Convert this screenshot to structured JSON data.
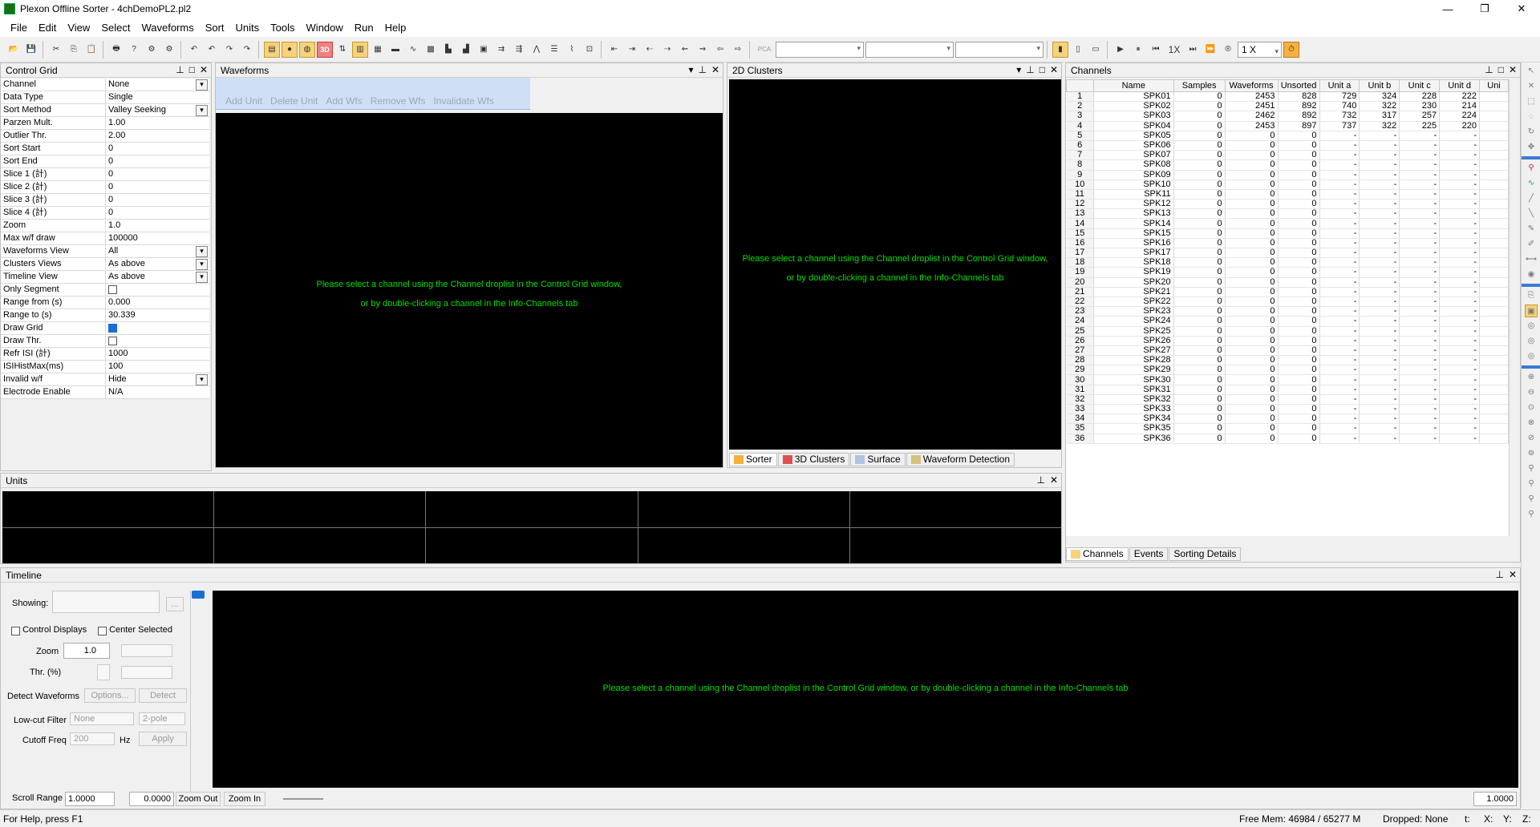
{
  "window": {
    "title": "Plexon Offline Sorter - 4chDemoPL2.pl2",
    "minimize": "—",
    "maximize": "❐",
    "close": "✕"
  },
  "menu": [
    "File",
    "Edit",
    "View",
    "Select",
    "Waveforms",
    "Sort",
    "Units",
    "Tools",
    "Window",
    "Run",
    "Help"
  ],
  "toolbar": {
    "pca_label": "PCA",
    "speed_label": "1X",
    "speed_value": "1 X"
  },
  "control_grid": {
    "title": "Control Grid",
    "rows": [
      {
        "k": "Channel",
        "v": "None",
        "type": "dd"
      },
      {
        "k": "Data Type",
        "v": "Single",
        "type": "text"
      },
      {
        "k": "Sort Method",
        "v": "Valley Seeking",
        "type": "dd"
      },
      {
        "k": "Parzen Mult.",
        "v": "1.00",
        "type": "text"
      },
      {
        "k": "Outlier Thr.",
        "v": "2.00",
        "type": "text"
      },
      {
        "k": "Sort Start",
        "v": "0",
        "type": "text"
      },
      {
        "k": "Sort End",
        "v": "0",
        "type": "text"
      },
      {
        "k": "Slice 1 (計)",
        "v": "0",
        "type": "text"
      },
      {
        "k": "Slice 2 (計)",
        "v": "0",
        "type": "text"
      },
      {
        "k": "Slice 3 (計)",
        "v": "0",
        "type": "text"
      },
      {
        "k": "Slice 4 (計)",
        "v": "0",
        "type": "text"
      },
      {
        "k": "Zoom",
        "v": "1.0",
        "type": "text"
      },
      {
        "k": "Max w/f draw",
        "v": "100000",
        "type": "text"
      },
      {
        "k": "Waveforms View",
        "v": "All",
        "type": "dd"
      },
      {
        "k": "Clusters Views",
        "v": "As above",
        "type": "dd"
      },
      {
        "k": "Timeline View",
        "v": "As above",
        "type": "dd"
      },
      {
        "k": "Only Segment",
        "v": "",
        "type": "chk"
      },
      {
        "k": "  Range from (s)",
        "v": "0.000",
        "type": "text"
      },
      {
        "k": "  Range to (s)",
        "v": "30.339",
        "type": "text"
      },
      {
        "k": "Draw Grid",
        "v": "",
        "type": "chkon"
      },
      {
        "k": "Draw Thr.",
        "v": "",
        "type": "chk"
      },
      {
        "k": "Refr ISI (計)",
        "v": "1000",
        "type": "text"
      },
      {
        "k": "ISIHistMax(ms)",
        "v": "100",
        "type": "text"
      },
      {
        "k": "Invalid w/f",
        "v": "Hide",
        "type": "dd"
      },
      {
        "k": "Electrode Enable",
        "v": "N/A",
        "type": "text"
      }
    ]
  },
  "waveforms": {
    "title": "Waveforms",
    "buttons": [
      "Add Unit",
      "Delete Unit",
      "Add Wfs",
      "Remove Wfs",
      "Invalidate Wfs"
    ],
    "msg1": "Please select a channel using the Channel droplist in the Control Grid window,",
    "msg2": "or by double-clicking a channel in the Info-Channels tab"
  },
  "clusters": {
    "title": "2D Clusters",
    "msg1": "Please select a channel using the Channel droplist in the Control Grid window,",
    "msg2": "or by double-clicking a channel in the Info-Channels tab",
    "tabs": [
      "Sorter",
      "3D Clusters",
      "Surface",
      "Waveform Detection"
    ]
  },
  "channels": {
    "title": "Channels",
    "columns": [
      "",
      "Name",
      "Samples",
      "Waveforms",
      "Unsorted",
      "Unit a",
      "Unit b",
      "Unit c",
      "Unit d",
      "Uni"
    ],
    "rows": [
      [
        "1",
        "SPK01",
        "0",
        "2453",
        "828",
        "729",
        "324",
        "228",
        "222"
      ],
      [
        "2",
        "SPK02",
        "0",
        "2451",
        "892",
        "740",
        "322",
        "230",
        "214"
      ],
      [
        "3",
        "SPK03",
        "0",
        "2462",
        "892",
        "732",
        "317",
        "257",
        "224"
      ],
      [
        "4",
        "SPK04",
        "0",
        "2453",
        "897",
        "737",
        "322",
        "225",
        "220"
      ],
      [
        "5",
        "SPK05",
        "0",
        "0",
        "0",
        "-",
        "-",
        "-",
        "-"
      ],
      [
        "6",
        "SPK06",
        "0",
        "0",
        "0",
        "-",
        "-",
        "-",
        "-"
      ],
      [
        "7",
        "SPK07",
        "0",
        "0",
        "0",
        "-",
        "-",
        "-",
        "-"
      ],
      [
        "8",
        "SPK08",
        "0",
        "0",
        "0",
        "-",
        "-",
        "-",
        "-"
      ],
      [
        "9",
        "SPK09",
        "0",
        "0",
        "0",
        "-",
        "-",
        "-",
        "-"
      ],
      [
        "10",
        "SPK10",
        "0",
        "0",
        "0",
        "-",
        "-",
        "-",
        "-"
      ],
      [
        "11",
        "SPK11",
        "0",
        "0",
        "0",
        "-",
        "-",
        "-",
        "-"
      ],
      [
        "12",
        "SPK12",
        "0",
        "0",
        "0",
        "-",
        "-",
        "-",
        "-"
      ],
      [
        "13",
        "SPK13",
        "0",
        "0",
        "0",
        "-",
        "-",
        "-",
        "-"
      ],
      [
        "14",
        "SPK14",
        "0",
        "0",
        "0",
        "-",
        "-",
        "-",
        "-"
      ],
      [
        "15",
        "SPK15",
        "0",
        "0",
        "0",
        "-",
        "-",
        "-",
        "-"
      ],
      [
        "16",
        "SPK16",
        "0",
        "0",
        "0",
        "-",
        "-",
        "-",
        "-"
      ],
      [
        "17",
        "SPK17",
        "0",
        "0",
        "0",
        "-",
        "-",
        "-",
        "-"
      ],
      [
        "18",
        "SPK18",
        "0",
        "0",
        "0",
        "-",
        "-",
        "-",
        "-"
      ],
      [
        "19",
        "SPK19",
        "0",
        "0",
        "0",
        "-",
        "-",
        "-",
        "-"
      ],
      [
        "20",
        "SPK20",
        "0",
        "0",
        "0",
        "-",
        "-",
        "-",
        "-"
      ],
      [
        "21",
        "SPK21",
        "0",
        "0",
        "0",
        "-",
        "-",
        "-",
        "-"
      ],
      [
        "22",
        "SPK22",
        "0",
        "0",
        "0",
        "-",
        "-",
        "-",
        "-"
      ],
      [
        "23",
        "SPK23",
        "0",
        "0",
        "0",
        "-",
        "-",
        "-",
        "-"
      ],
      [
        "24",
        "SPK24",
        "0",
        "0",
        "0",
        "-",
        "-",
        "-",
        "-"
      ],
      [
        "25",
        "SPK25",
        "0",
        "0",
        "0",
        "-",
        "-",
        "-",
        "-"
      ],
      [
        "26",
        "SPK26",
        "0",
        "0",
        "0",
        "-",
        "-",
        "-",
        "-"
      ],
      [
        "27",
        "SPK27",
        "0",
        "0",
        "0",
        "-",
        "-",
        "-",
        "-"
      ],
      [
        "28",
        "SPK28",
        "0",
        "0",
        "0",
        "-",
        "-",
        "-",
        "-"
      ],
      [
        "29",
        "SPK29",
        "0",
        "0",
        "0",
        "-",
        "-",
        "-",
        "-"
      ],
      [
        "30",
        "SPK30",
        "0",
        "0",
        "0",
        "-",
        "-",
        "-",
        "-"
      ],
      [
        "31",
        "SPK31",
        "0",
        "0",
        "0",
        "-",
        "-",
        "-",
        "-"
      ],
      [
        "32",
        "SPK32",
        "0",
        "0",
        "0",
        "-",
        "-",
        "-",
        "-"
      ],
      [
        "33",
        "SPK33",
        "0",
        "0",
        "0",
        "-",
        "-",
        "-",
        "-"
      ],
      [
        "34",
        "SPK34",
        "0",
        "0",
        "0",
        "-",
        "-",
        "-",
        "-"
      ],
      [
        "35",
        "SPK35",
        "0",
        "0",
        "0",
        "-",
        "-",
        "-",
        "-"
      ],
      [
        "36",
        "SPK36",
        "0",
        "0",
        "0",
        "-",
        "-",
        "-",
        "-"
      ]
    ],
    "tabs": [
      "Channels",
      "Events",
      "Sorting Details"
    ]
  },
  "units": {
    "title": "Units"
  },
  "timeline": {
    "title": "Timeline",
    "showing_label": "Showing:",
    "ellipsis": "...",
    "control_displays": "Control Displays",
    "center_selected": "Center Selected",
    "zoom_label": "Zoom",
    "zoom_value": "1.0",
    "thr_label": "Thr. (%)",
    "detect_label": "Detect Waveforms",
    "options_btn": "Options...",
    "detect_btn": "Detect",
    "lowcut_label": "Low-cut Filter",
    "lowcut_value": "None",
    "pole_value": "2-pole",
    "cutoff_label": "Cutoff Freq",
    "cutoff_value": "200",
    "hz": "Hz",
    "apply_btn": "Apply",
    "scroll_label": "Scroll Range",
    "scroll_value": "1.0000",
    "start_value": "0.0000",
    "zoom_out": "Zoom Out",
    "zoom_in": "Zoom In",
    "end_value": "1.0000",
    "msg": "Please select a channel using the Channel droplist in the Control Grid window, or by double-clicking a channel in the Info-Channels tab"
  },
  "status": {
    "help": "For Help, press F1",
    "mem": "Free Mem: 46984 / 65277 M",
    "dropped": "Dropped: None",
    "t": "t:",
    "x": "X:",
    "y": "Y:",
    "z": "Z:"
  }
}
